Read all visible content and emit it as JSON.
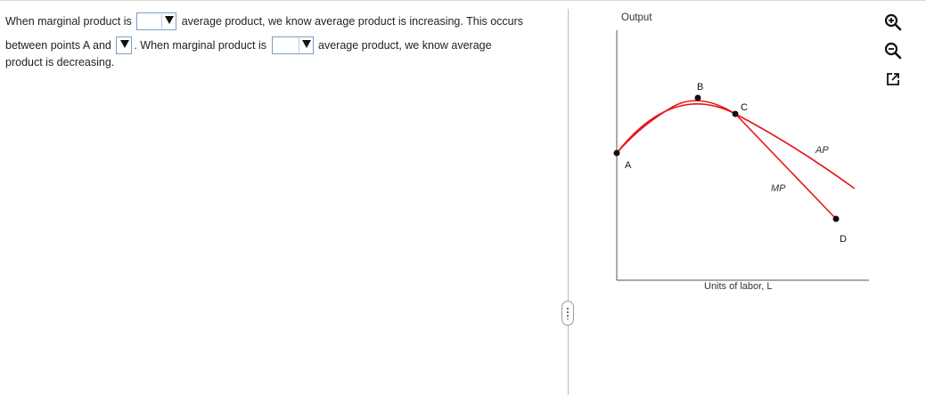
{
  "question": {
    "text_1": "When marginal product is",
    "text_2": "average product, we know average product is increasing. This occurs",
    "text_3": "between points A and",
    "text_4": ". When marginal product is",
    "text_5": "average product, we know average",
    "text_6": "product is decreasing.",
    "dropdown_1_value": "",
    "dropdown_2_value": "",
    "dropdown_3_value": ""
  },
  "graph": {
    "y_axis_label": "Output",
    "x_axis_label": "Units of labor, L",
    "point_a": "A",
    "point_b": "B",
    "point_c": "C",
    "point_d": "D",
    "curve_ap_label": "AP",
    "curve_mp_label": "MP",
    "curve_color": "#e8141b",
    "point_color": "#111111"
  },
  "tools": {
    "zoom_in_icon": "zoom-in-icon",
    "zoom_out_icon": "zoom-out-icon",
    "popout_icon": "external-link-icon"
  }
}
